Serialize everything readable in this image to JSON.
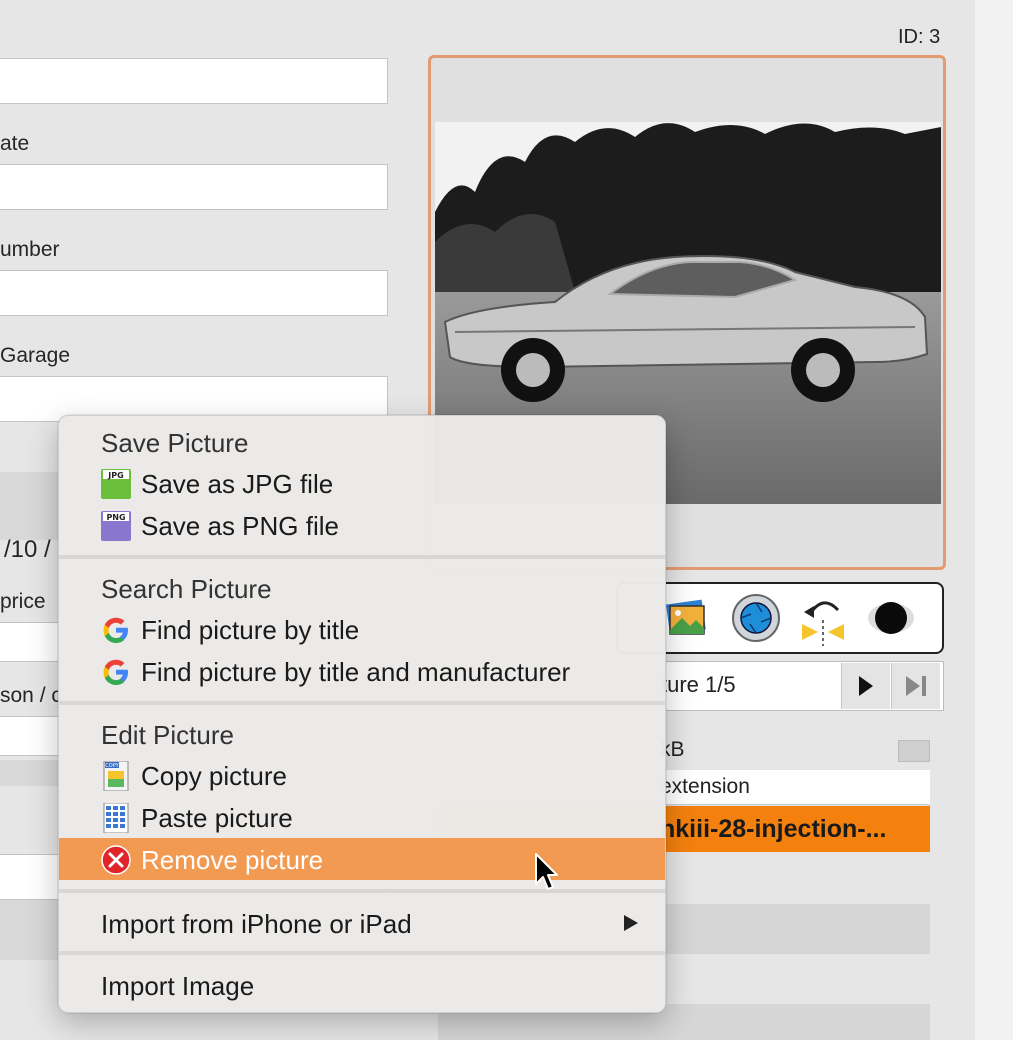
{
  "record": {
    "id_label": "ID: 3"
  },
  "form": {
    "labels": {
      "date": "ate",
      "number": "umber",
      "garage": "Garage",
      "rating": "/10 /",
      "price": "price",
      "reason": "son / c"
    }
  },
  "picture_nav": {
    "label": "ture 1/5"
  },
  "file_info": {
    "size_label": "kB"
  },
  "table": {
    "column_header": "extension",
    "selected_row": "nkiii-28-injection-..."
  },
  "context_menu": {
    "save_header": "Save Picture",
    "save_jpg": "Save as JPG file",
    "save_png": "Save as PNG file",
    "search_header": "Search Picture",
    "find_title": "Find picture by title",
    "find_title_manufacturer": "Find picture by title and manufacturer",
    "edit_header": "Edit Picture",
    "copy": "Copy picture",
    "paste": "Paste picture",
    "remove": "Remove picture",
    "import_iphone": "Import from iPhone or iPad",
    "import_image": "Import Image",
    "icons": {
      "jpg_badge": "JPG",
      "png_badge": "PNG",
      "copy_badge": "COPY"
    }
  },
  "colors": {
    "highlight": "#f29a52",
    "selection_row": "#f4800e",
    "photo_frame": "#e39c70",
    "jpg_icon": "#6cbf3a",
    "png_icon": "#8877cc",
    "remove_icon": "#e0262b"
  }
}
